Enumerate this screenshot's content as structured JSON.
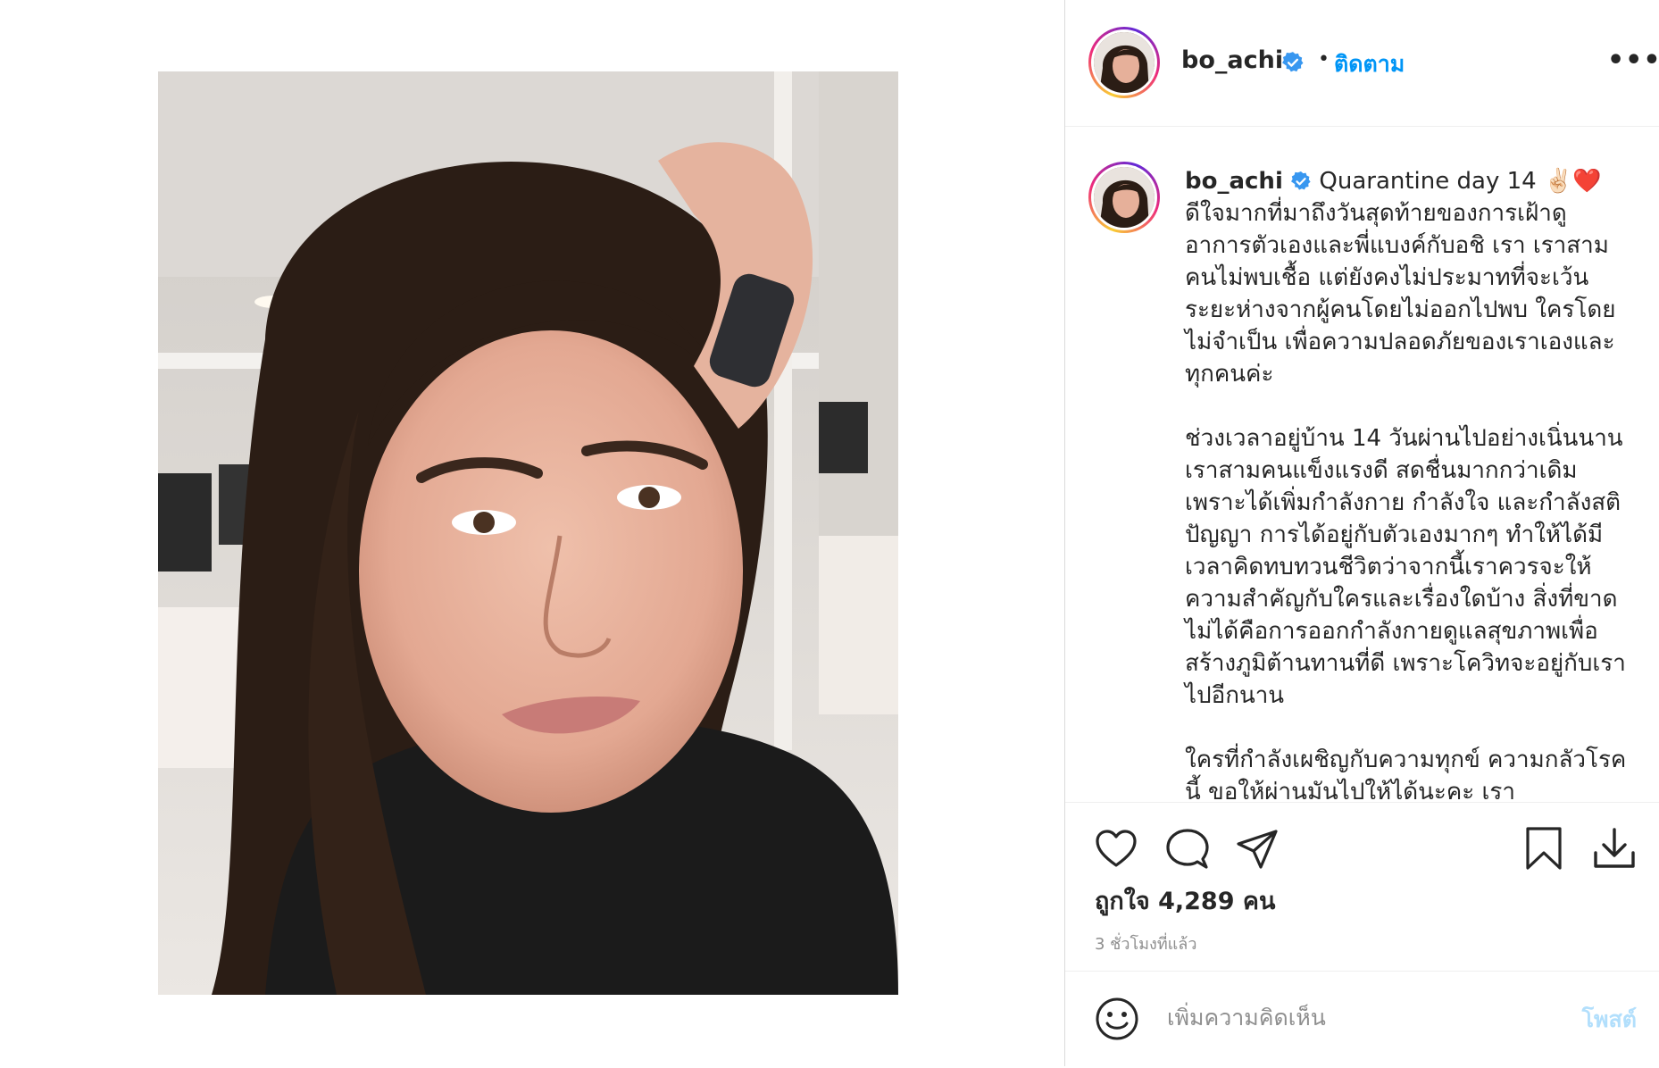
{
  "post": {
    "username": "bo_achi",
    "follow_label": "ติดตาม",
    "separator": "•",
    "more_label": "•••",
    "verified_color": "#3897f0"
  },
  "caption": {
    "username": "bo_achi",
    "headline": "Quarantine day 14 ✌🏻❤️",
    "text": "ดีใจมากที่มาถึงวันสุดท้ายของการเฝ้าดูอาการตัวเองและพี่แบงค์กับอชิ เรา เราสามคนไม่พบเชื้อ แต่ยังคงไม่ประมาทที่จะเว้นระยะห่างจากผู้คนโดยไม่ออกไปพบ ใครโดยไม่จำเป็น เพื่อความปลอดภัยของเราเองและทุกคนค่ะ\n\nช่วงเวลาอยู่บ้าน 14 วันผ่านไปอย่างเนิ่นนาน เราสามคนแข็งแรงดี สดชื่นมากกว่าเดิม เพราะได้เพิ่มกำลังกาย กำลังใจ และกำลังสติปัญญา การได้อยู่กับตัวเองมากๆ ทำให้ได้มีเวลาคิดทบทวนชีวิตว่าจากนี้เราควรจะให้ความสำคัญกับใครและเรื่องใดบ้าง สิ่งที่ขาดไม่ได้คือการออกกำลังกายดูแลสุขภาพเพื่อสร้างภูมิต้านทานที่ดี เพราะโควิทจะอยู่กับเราไปอีกนาน\n\nใครที่กำลังเผชิญกับความทุกข์ ความกลัวโรคนี้ ขอให้ผ่านมันไปให้ได้นะคะ เรา"
  },
  "actions": {
    "like_icon": "heart-icon",
    "comment_icon": "comment-icon",
    "share_icon": "share-icon",
    "save_icon": "bookmark-icon",
    "download_icon": "download-icon"
  },
  "stats": {
    "likes": "ถูกใจ 4,289 คน",
    "timestamp": "3 ชั่วโมงที่แล้ว"
  },
  "comment": {
    "placeholder": "เพิ่มความคิดเห็น",
    "post_label": "โพสต์",
    "emoji_icon": "emoji-icon"
  },
  "colors": {
    "link": "#0095f6",
    "post_disabled": "#b2dffc",
    "muted": "#8e8e8e",
    "text": "#262626"
  }
}
